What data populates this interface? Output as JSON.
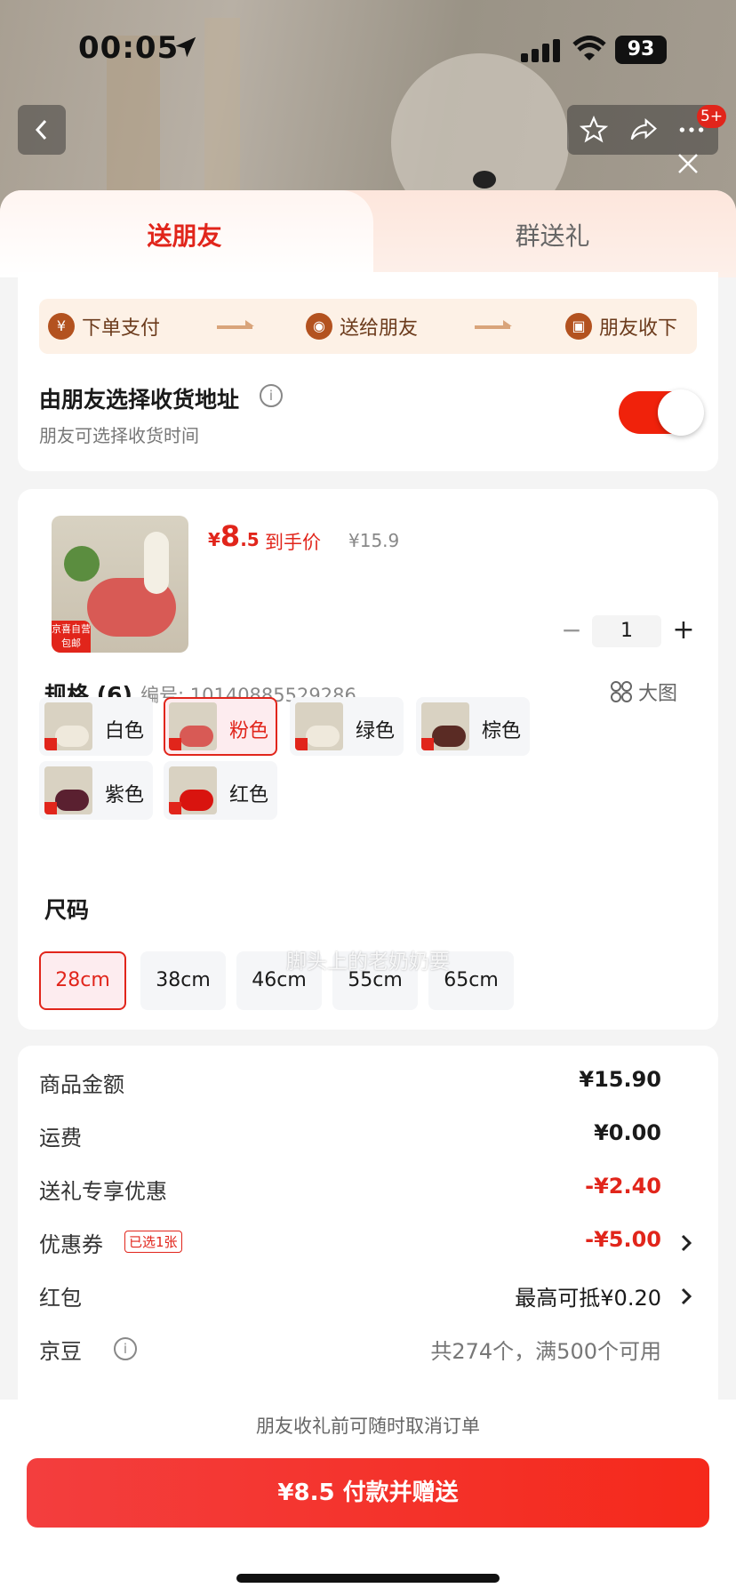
{
  "status": {
    "time": "00:05",
    "battery": "93"
  },
  "header": {
    "badge": "5+"
  },
  "tabs": {
    "active": "送朋友",
    "inactive": "群送礼"
  },
  "flow": {
    "steps": [
      "下单支付",
      "送给朋友",
      "朋友收下"
    ],
    "icons": [
      "yuan-icon",
      "wechat-icon",
      "gift-icon"
    ]
  },
  "address": {
    "title": "由朋友选择收货地址",
    "subtitle": "朋友可选择收货时间",
    "toggle_on": true
  },
  "product": {
    "tag_line1": "京喜自营",
    "tag_line2": "包邮",
    "price_currency": "¥",
    "price_int": "8",
    "price_dec": ".5",
    "price_label": "到手价",
    "original_price": "¥15.9",
    "quantity": "1"
  },
  "spec": {
    "title": "规格 (6)",
    "code": "编号: 10140885529286",
    "big_image": "大图",
    "options": [
      {
        "label": "白色",
        "selected": false,
        "swatch": "#efe9dc"
      },
      {
        "label": "粉色",
        "selected": true,
        "swatch": "#d85a55"
      },
      {
        "label": "绿色",
        "selected": false,
        "swatch": "#efe9dc"
      },
      {
        "label": "棕色",
        "selected": false,
        "swatch": "#5a2b24"
      },
      {
        "label": "紫色",
        "selected": false,
        "swatch": "#5a2030"
      },
      {
        "label": "红色",
        "selected": false,
        "swatch": "#d9140f"
      }
    ]
  },
  "size": {
    "title": "尺码",
    "options": [
      {
        "label": "28cm",
        "selected": true
      },
      {
        "label": "38cm",
        "selected": false
      },
      {
        "label": "46cm",
        "selected": false
      },
      {
        "label": "55cm",
        "selected": false
      },
      {
        "label": "65cm",
        "selected": false
      }
    ]
  },
  "watermark": "脚头上的老奶奶要",
  "fees": [
    {
      "label": "商品金额",
      "value": "¥15.90"
    },
    {
      "label": "运费",
      "value": "¥0.00"
    },
    {
      "label": "送礼专享优惠",
      "value": "-¥2.40"
    },
    {
      "label": "优惠券",
      "tag": "已选1张",
      "value": "-¥5.00"
    },
    {
      "label": "红包",
      "value": "最高可抵¥0.20"
    },
    {
      "label": "京豆",
      "value": "共274个，满500个可用"
    }
  ],
  "footer": {
    "note": "朋友收礼前可随时取消订单",
    "pay_button": "¥8.5 付款并赠送"
  },
  "colors": {
    "accent": "#e1251b",
    "flow_bg": "#fdf1e6",
    "flow_icon": "#b3521f"
  }
}
